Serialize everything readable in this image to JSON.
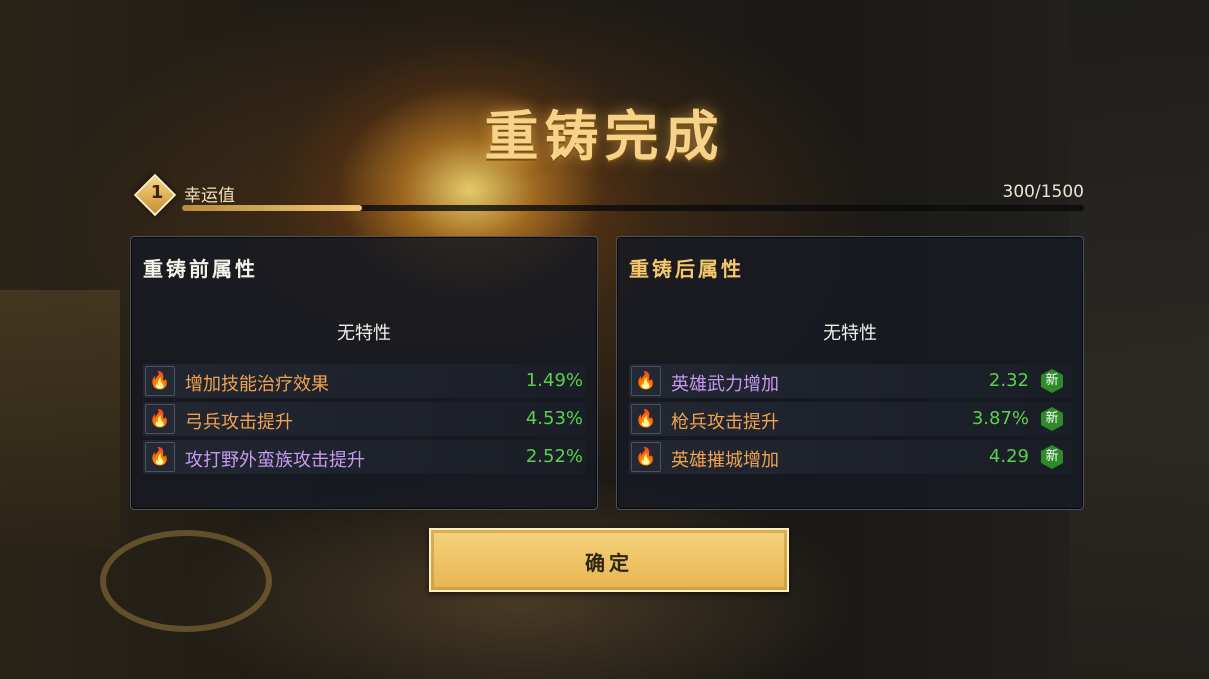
{
  "title": "重铸完成",
  "luck": {
    "level": "1",
    "label": "幸运值",
    "value_text": "300/1500",
    "progress": 0.2
  },
  "before": {
    "title": "重铸前属性",
    "trait": "无特性",
    "attributes": [
      {
        "name": "增加技能治疗效果",
        "value": "1.49%",
        "color": "orange"
      },
      {
        "name": "弓兵攻击提升",
        "value": "4.53%",
        "color": "orange"
      },
      {
        "name": "攻打野外蛮族攻击提升",
        "value": "2.52%",
        "color": "purple"
      }
    ]
  },
  "after": {
    "title": "重铸后属性",
    "trait": "无特性",
    "attributes": [
      {
        "name": "英雄武力增加",
        "value": "2.32",
        "color": "purple",
        "badge": "新"
      },
      {
        "name": "枪兵攻击提升",
        "value": "3.87%",
        "color": "orange",
        "badge": "新"
      },
      {
        "name": "英雄摧城增加",
        "value": "4.29",
        "color": "orange",
        "badge": "新"
      }
    ]
  },
  "icons": {
    "attribute": "flame-icon"
  },
  "colors": {
    "orange": "#f1a24e",
    "purple": "#c79af2",
    "value_green": "#5ad04e",
    "gold": "#f6d27b"
  },
  "confirm_label": "确定"
}
